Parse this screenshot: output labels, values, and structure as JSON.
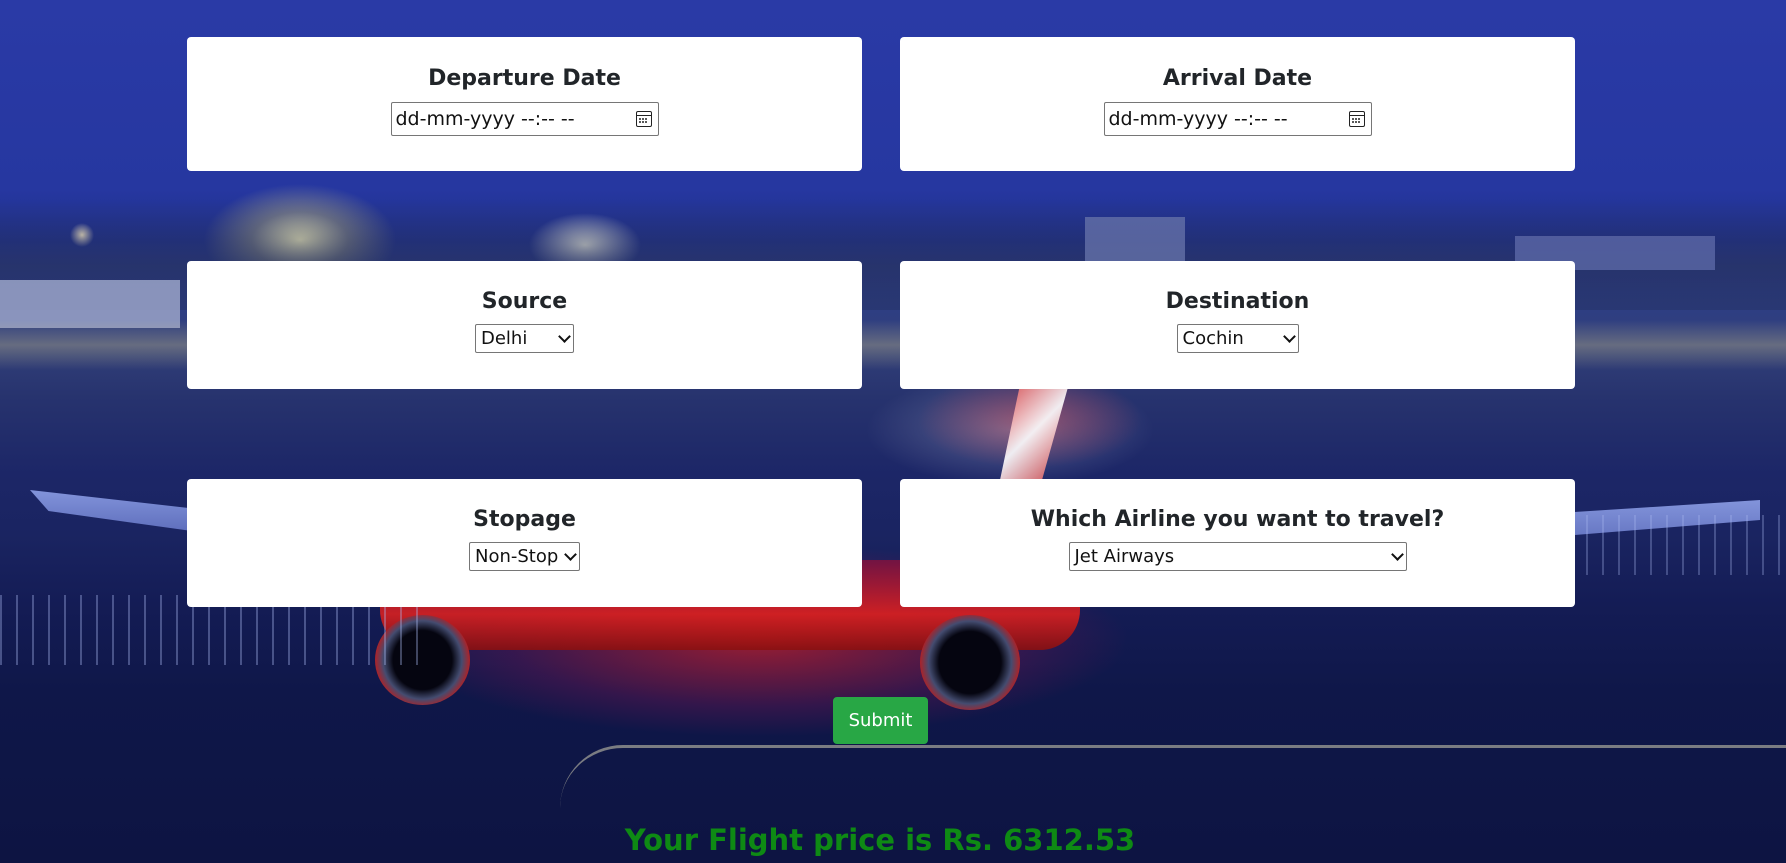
{
  "form": {
    "departure": {
      "label": "Departure Date",
      "placeholder": "dd-mm-yyyy --:-- --"
    },
    "arrival": {
      "label": "Arrival Date",
      "placeholder": "dd-mm-yyyy --:-- --"
    },
    "source": {
      "label": "Source",
      "value": "Delhi"
    },
    "destination": {
      "label": "Destination",
      "value": "Cochin"
    },
    "stopage": {
      "label": "Stopage",
      "value": "Non-Stop"
    },
    "airline": {
      "label": "Which Airline you want to travel?",
      "value": "Jet Airways"
    },
    "submit_label": "Submit"
  },
  "result": {
    "text": "Your Flight price is Rs. 6312.53"
  },
  "colors": {
    "submit": "#28a745",
    "result_text": "#0e8a14",
    "card": "#ffffff"
  },
  "icons": {
    "date_picker": "calendar-icon",
    "select": "chevron-down-icon"
  }
}
